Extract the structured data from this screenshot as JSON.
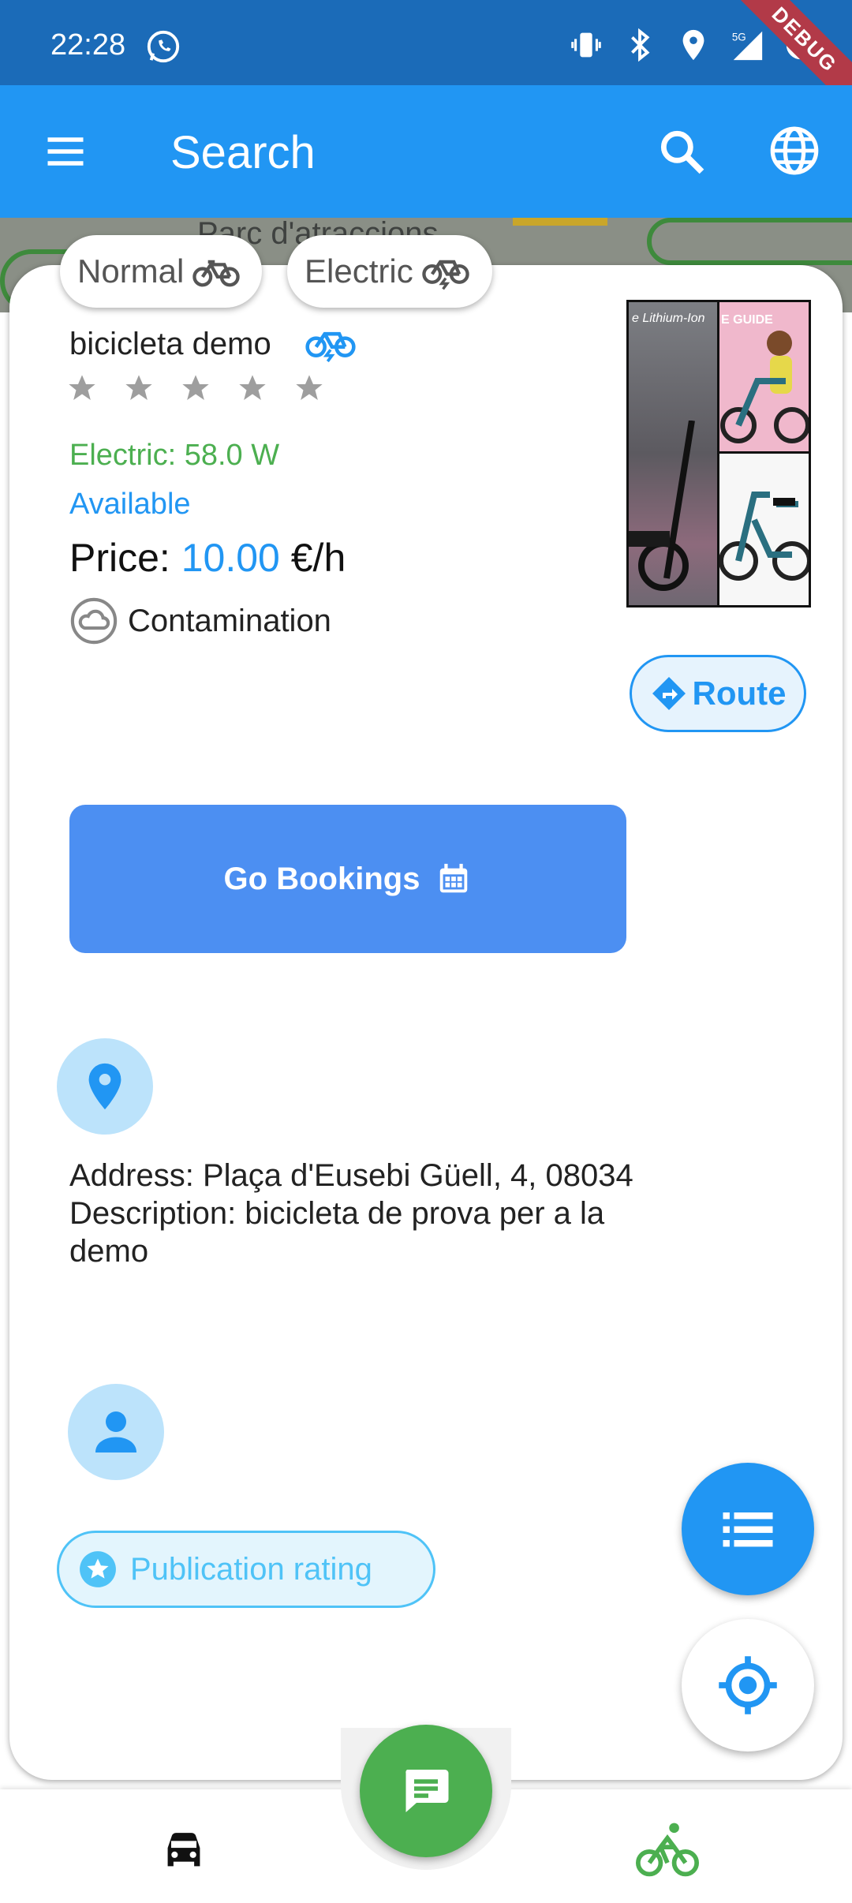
{
  "status_bar": {
    "time": "22:28",
    "network": "5G",
    "debug_label": "DEBUG"
  },
  "app_bar": {
    "title": "Search"
  },
  "map": {
    "label": "Parc d'atraccions"
  },
  "filters": [
    {
      "label": "Normal",
      "icon": "bicycle-icon"
    },
    {
      "label": "Electric",
      "icon": "electric-bicycle-icon"
    }
  ],
  "bike": {
    "name": "bicicleta demo",
    "rating": 0,
    "rating_max": 5,
    "power": "Electric: 58.0 W",
    "status": "Available",
    "price_label": "Price:",
    "price_value": "10.00",
    "price_unit": "€/h",
    "contamination": "Contamination",
    "photo_text_left": "e Lithium-Ion",
    "photo_text_right": "E GUIDE"
  },
  "actions": {
    "route": "Route",
    "bookings": "Go Bookings",
    "publication_rating": "Publication rating"
  },
  "details": {
    "address_line": "Address:  Plaça d'Eusebi Güell, 4, 08034",
    "description_line": "Description:  bicicleta de prova per a la demo"
  },
  "colors": {
    "primary": "#2196f3",
    "status_bar": "#1b6bb8",
    "green": "#4caf50",
    "bookings": "#4c8ff2",
    "light_blue": "#4fc3f7"
  }
}
